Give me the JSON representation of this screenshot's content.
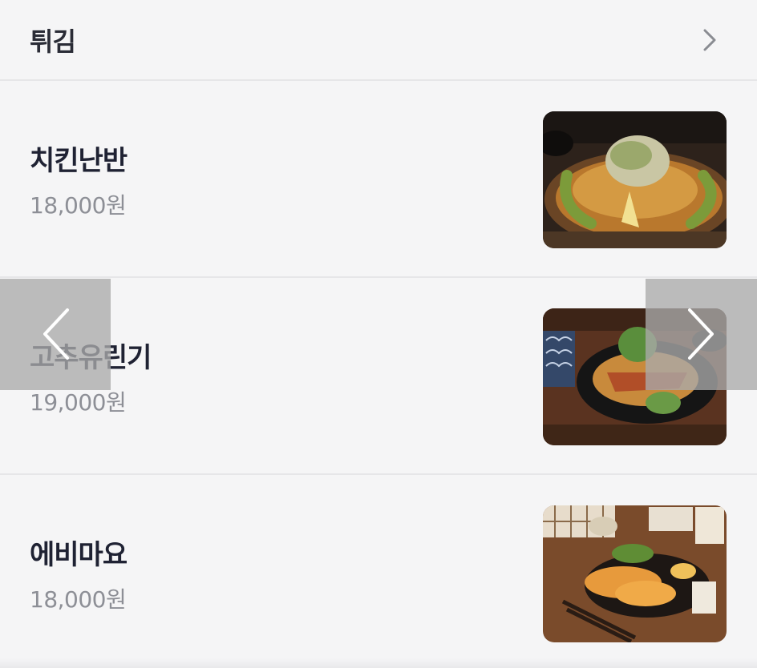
{
  "section": {
    "title": "튀김",
    "more_icon": "chevron-right-icon"
  },
  "menu_items": [
    {
      "name": "치킨난반",
      "price": "18,000원",
      "image": "chicken-nanban-photo"
    },
    {
      "name": "고추유린기",
      "price": "19,000원",
      "image": "yuringi-photo"
    },
    {
      "name": "에비마요",
      "price": "18,000원",
      "image": "ebi-mayo-photo"
    }
  ],
  "carousel": {
    "prev_icon": "chevron-left-icon",
    "next_icon": "chevron-right-icon"
  },
  "colors": {
    "background": "#f5f5f6",
    "divider": "#e6e6e8",
    "title_text": "#1f2233",
    "price_text": "#8d8f96",
    "overlay": "#aaaaaa"
  }
}
